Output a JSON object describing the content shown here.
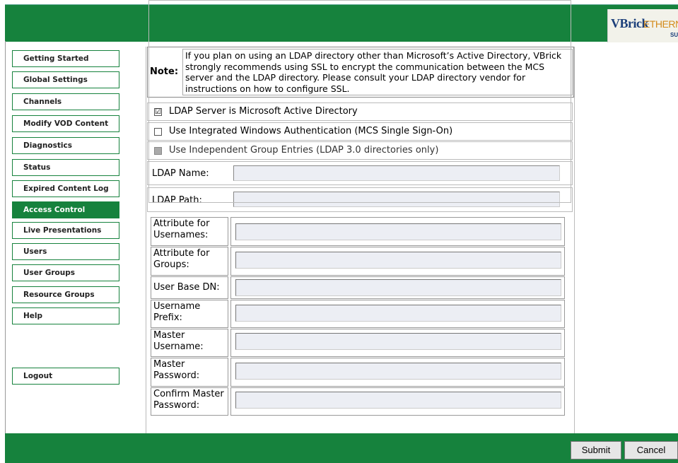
{
  "logo": {
    "text_vbrick": "VBrick",
    "text_ethernet": "ETHERNET",
    "text_suite": "SUI"
  },
  "nav": {
    "items": [
      {
        "label": "Getting Started",
        "active": false
      },
      {
        "label": "Global Settings",
        "active": false
      },
      {
        "label": "Channels",
        "active": false
      },
      {
        "label": "Modify VOD Content",
        "active": false
      },
      {
        "label": "Diagnostics",
        "active": false
      },
      {
        "label": "Status",
        "active": false
      },
      {
        "label": "Expired Content Log",
        "active": false
      },
      {
        "label": "Access Control",
        "active": true
      },
      {
        "label": "Live Presentations",
        "active": false
      },
      {
        "label": "Users",
        "active": false
      },
      {
        "label": "User Groups",
        "active": false
      },
      {
        "label": "Resource Groups",
        "active": false
      },
      {
        "label": "Help",
        "active": false
      }
    ],
    "logout": "Logout"
  },
  "note": {
    "label": "Note:",
    "text": "If you plan on using an LDAP directory other than Microsoft’s Active Directory, VBrick strongly recommends using SSL to encrypt the communication between the MCS server and the LDAP directory. Please consult your LDAP directory vendor for instructions on how to configure SSL."
  },
  "options": {
    "active_directory": {
      "label": "LDAP Server is Microsoft Active Directory",
      "checked": true,
      "mark": "☑"
    },
    "integrated_auth": {
      "label": "Use Integrated Windows Authentication (MCS Single Sign-On)",
      "checked": false
    },
    "independent_groups": {
      "label": "Use Independent Group Entries (LDAP 3.0 directories only)",
      "checked": false,
      "disabled": true
    }
  },
  "fields": {
    "ldap_name": {
      "label": "LDAP Name:",
      "value": ""
    },
    "ldap_path": {
      "label": "LDAP Path:",
      "value": ""
    }
  },
  "attributes": [
    {
      "label": "Attribute for Usernames:",
      "value": ""
    },
    {
      "label": "Attribute for Groups:",
      "value": ""
    },
    {
      "label": "User Base DN:",
      "value": ""
    },
    {
      "label": "Username Prefix:",
      "value": ""
    },
    {
      "label": "Master Username:",
      "value": ""
    },
    {
      "label": "Master Password:",
      "value": ""
    },
    {
      "label": "Confirm Master Password:",
      "value": ""
    }
  ],
  "buttons": {
    "submit": "Submit",
    "cancel": "Cancel"
  },
  "colors": {
    "brand_green": "#16823d",
    "input_bg": "#eceef4"
  }
}
